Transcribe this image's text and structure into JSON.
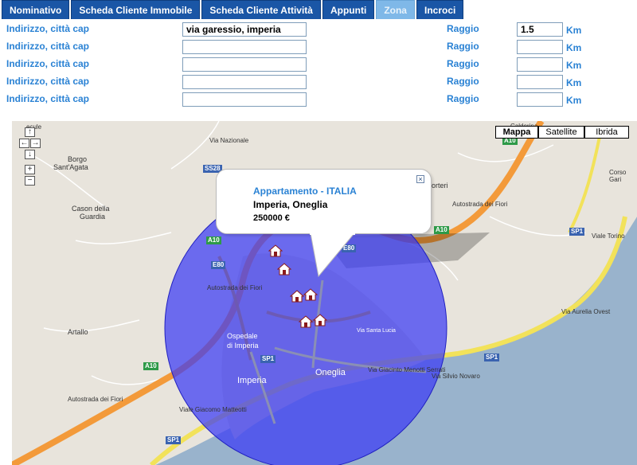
{
  "tabs": [
    {
      "label": "Nominativo",
      "active": false
    },
    {
      "label": "Scheda Cliente Immobile",
      "active": false
    },
    {
      "label": "Scheda Cliente Attività",
      "active": false
    },
    {
      "label": "Appunti",
      "active": false
    },
    {
      "label": "Zona",
      "active": true
    },
    {
      "label": "Incroci",
      "active": false
    }
  ],
  "form": {
    "address_label": "Indirizzo, città cap",
    "radius_label": "Raggio",
    "unit_label": "Km",
    "rows": [
      {
        "address": "via garessio, imperia",
        "radius": "1.5"
      },
      {
        "address": "",
        "radius": ""
      },
      {
        "address": "",
        "radius": ""
      },
      {
        "address": "",
        "radius": ""
      },
      {
        "address": "",
        "radius": ""
      }
    ]
  },
  "map": {
    "controls": {
      "up": "↑",
      "left": "←",
      "right": "→",
      "down": "↓",
      "zoom_in": "+",
      "zoom_out": "−"
    },
    "map_types": {
      "map": "Mappa",
      "satellite": "Satellite",
      "hybrid": "Ibrida"
    },
    "info_window": {
      "title": "Appartamento - ITALIA",
      "place": "Imperia, Oneglia",
      "price": "250000 €",
      "close": "×"
    },
    "labels": {
      "borgo": "Borgo",
      "santagata": "Sant'Agata",
      "cason": "Cason della",
      "guardia": "Guardia",
      "artallo": "Artallo",
      "ospedale": "Ospedale",
      "ospedale2": "di Imperia",
      "imperia": "Imperia",
      "oneglia": "Oneglia",
      "via_giacinto": "Via Giacinto Menotti Serrati",
      "via_silvio": "Via Silvio Novaro",
      "via_aurelia": "Via Aurelia Ovest",
      "viale_matteotti": "Viale Giacomo Matteotti",
      "autostrada_fiori": "Autostrada dei Fiori",
      "autostrada_fiori2": "Autostrada dei Fiori",
      "autostrada_fiori3": "Autostrada dei Fiori",
      "nazionale": "Via Nazionale",
      "sp1": "SP1",
      "a10": "A10",
      "ss28": "SS28",
      "e80": "E80",
      "via_torino": "Viale Torino",
      "corso": "Corso Gari",
      "porteri": "orteri",
      "cipressa": "Calderina",
      "ecule": "ecule",
      "sarta": "Via Santa Lucia"
    }
  }
}
